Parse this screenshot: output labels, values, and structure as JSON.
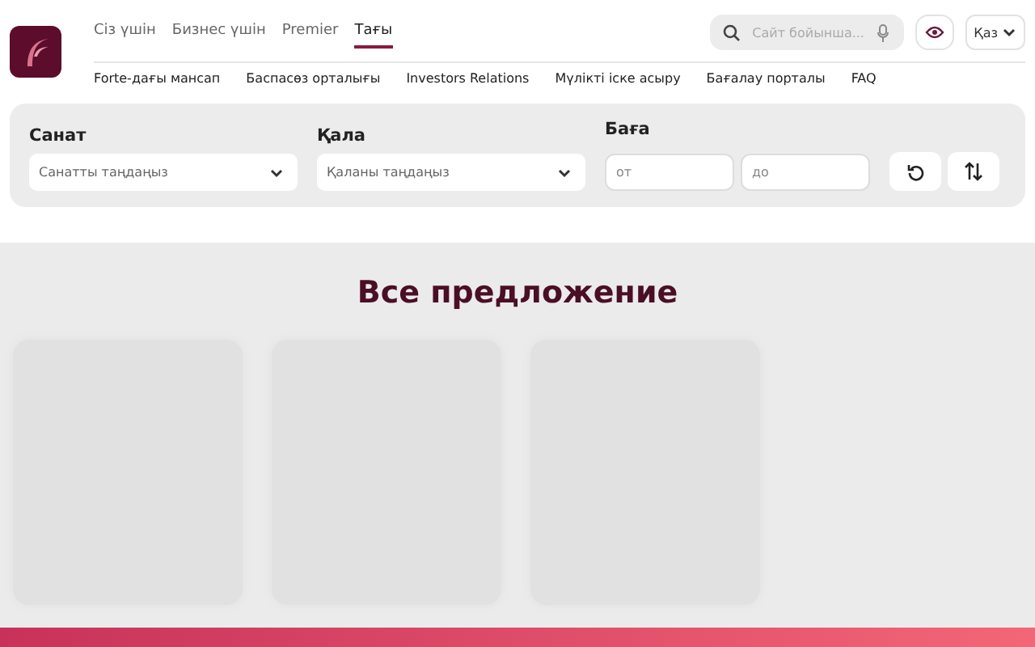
{
  "header": {
    "tabs": [
      {
        "label": "Сіз үшін",
        "selected": false
      },
      {
        "label": "Бизнес үшін",
        "selected": false
      },
      {
        "label": "Premier",
        "selected": false
      },
      {
        "label": "Тағы",
        "selected": true
      }
    ],
    "search": {
      "placeholder": "Сайт бойынша..."
    },
    "language": "Қаз",
    "links": [
      "Forte-дағы мансап",
      "Баспасөз орталығы",
      "Investors Relations",
      "Мүлікті іске асыру",
      "Бағалау порталы",
      "FAQ"
    ]
  },
  "filters": {
    "category": {
      "label": "Санат",
      "placeholder": "Санатты таңдаңыз"
    },
    "city": {
      "label": "Қала",
      "placeholder": "Қаланы таңдаңыз"
    },
    "price": {
      "label": "Баға",
      "from_placeholder": "от",
      "to_placeholder": "до"
    }
  },
  "offers": {
    "title": "Все предложение",
    "cards": [
      {
        "kind": "skeleton"
      },
      {
        "kind": "skeleton"
      },
      {
        "kind": "skeleton"
      }
    ]
  }
}
